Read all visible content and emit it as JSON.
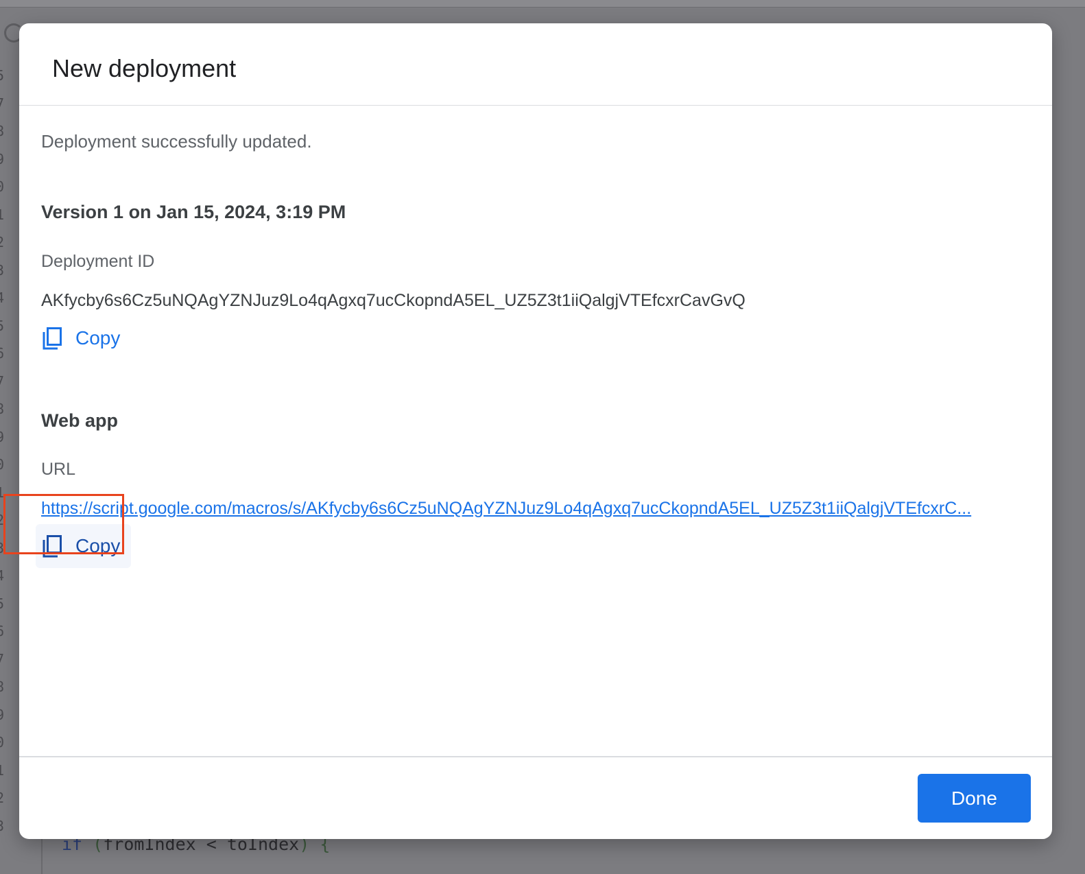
{
  "dialog": {
    "title": "New deployment",
    "status": "Deployment successfully updated.",
    "version_heading": "Version 1 on Jan 15, 2024, 3:19 PM",
    "deployment_id_label": "Deployment ID",
    "deployment_id_value": "AKfycby6s6Cz5uNQAgYZNJuz9Lo4qAgxq7ucCkopndA5EL_UZ5Z3t1iiQalgjVTEfcxrCavGvQ",
    "copy_id_label": "Copy",
    "web_app_heading": "Web app",
    "url_label": "URL",
    "url_value": "https://script.google.com/macros/s/AKfycby6s6Cz5uNQAgYZNJuz9Lo4qAgxq7ucCkopndA5EL_UZ5Z3t1iiQalgjVTEfcxrC...",
    "copy_url_label": "Copy",
    "done_label": "Done"
  },
  "background_code": {
    "keyword": "if",
    "open_paren": "(",
    "expression": "fromIndex < toIndex",
    "close": ") {"
  },
  "icons": {
    "copy": "copy-icon",
    "editor": "refresh-icon"
  },
  "colors": {
    "accent": "#1a73e8",
    "highlight": "#e8431d",
    "scrim": "#7c7c80"
  }
}
